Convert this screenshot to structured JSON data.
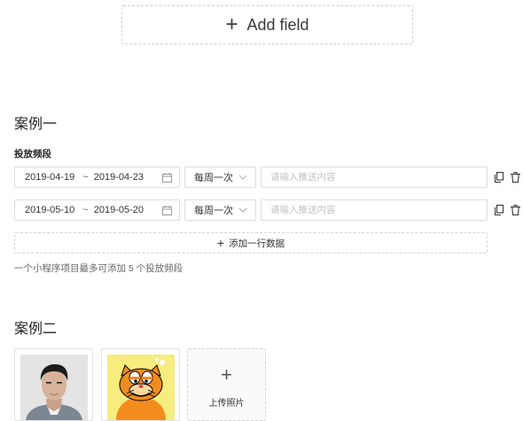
{
  "add_field": {
    "label": "Add field"
  },
  "case1": {
    "title": "案例一",
    "field_label": "投放频段",
    "rows": [
      {
        "start": "2019-04-19",
        "separator": "~",
        "end": "2019-04-23",
        "frequency": "每周一次",
        "placeholder": "请输入推送内容"
      },
      {
        "start": "2019-05-10",
        "separator": "~",
        "end": "2019-05-20",
        "frequency": "每周一次",
        "placeholder": "请输入推送内容"
      }
    ],
    "add_row_label": "添加一行数据",
    "hint": "一个小程序项目最多可添加 5 个投放频段"
  },
  "case2": {
    "title": "案例二",
    "upload_label": "上传照片"
  },
  "colors": {
    "border": "#dcdcdc",
    "placeholder": "#c2c2c2",
    "text": "#333333",
    "hint": "#666666"
  }
}
